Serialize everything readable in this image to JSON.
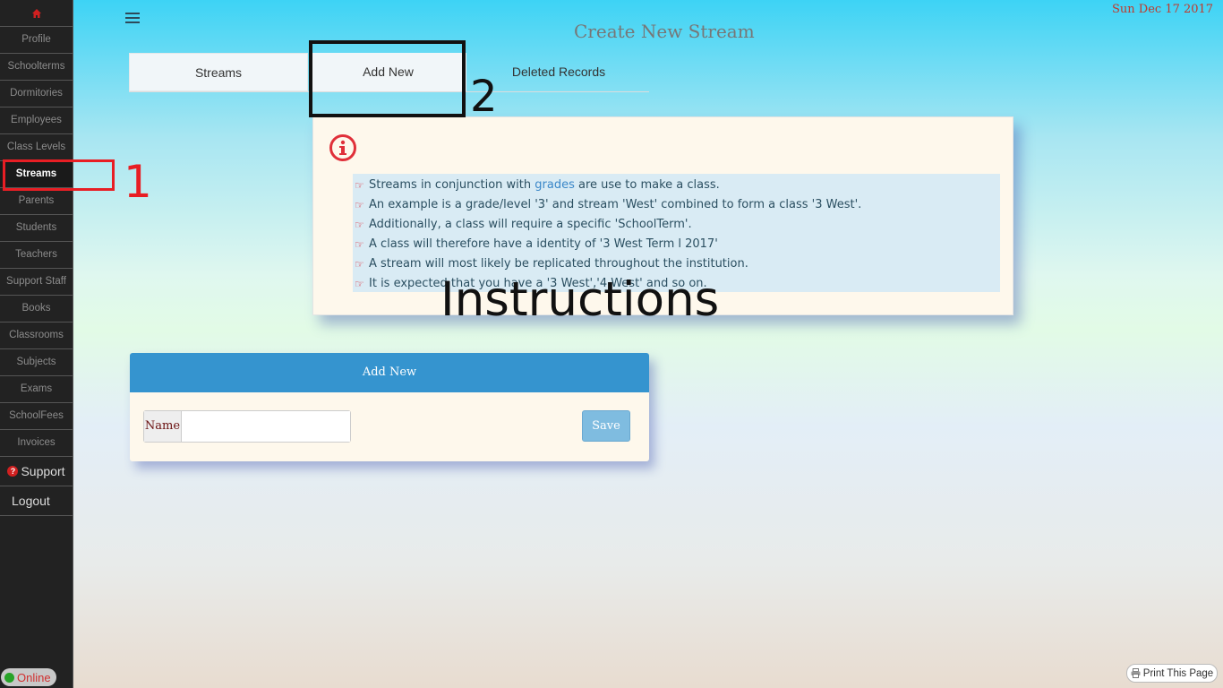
{
  "header": {
    "date": "Sun Dec 17 2017",
    "page_title": "Create New Stream"
  },
  "sidebar": {
    "home_icon": "home-icon",
    "items": [
      {
        "label": "Profile",
        "active": false
      },
      {
        "label": "Schoolterms",
        "active": false
      },
      {
        "label": "Dormitories",
        "active": false
      },
      {
        "label": "Employees",
        "active": false
      },
      {
        "label": "Class Levels",
        "active": false
      },
      {
        "label": "Streams",
        "active": true
      },
      {
        "label": "Parents",
        "active": false
      },
      {
        "label": "Students",
        "active": false
      },
      {
        "label": "Teachers",
        "active": false
      },
      {
        "label": "Support Staff",
        "active": false
      },
      {
        "label": "Books",
        "active": false
      },
      {
        "label": "Classrooms",
        "active": false
      },
      {
        "label": "Subjects",
        "active": false
      },
      {
        "label": "Exams",
        "active": false
      },
      {
        "label": "SchoolFees",
        "active": false
      },
      {
        "label": "Invoices",
        "active": false
      }
    ],
    "support_label": "Support",
    "logout_label": "Logout",
    "online_label": "Online"
  },
  "tabs": [
    {
      "label": "Streams"
    },
    {
      "label": "Add New"
    },
    {
      "label": "Deleted Records"
    }
  ],
  "annotations": {
    "marker_1": "1",
    "marker_2": "2",
    "instructions_label": "Instructions"
  },
  "info": {
    "lines": [
      {
        "pre": "Streams in conjunction with ",
        "link": "grades",
        "post": " are use to make a class."
      },
      {
        "pre": "An example is a grade/level '3' and stream 'West' combined to form a class '3 West'.",
        "link": "",
        "post": ""
      },
      {
        "pre": "Additionally, a class will require a specific 'SchoolTerm'.",
        "link": "",
        "post": ""
      },
      {
        "pre": "A class will therefore have a identity of '3 West Term l 2017'",
        "link": "",
        "post": ""
      },
      {
        "pre": "A stream will most likely be replicated throughout the institution.",
        "link": "",
        "post": ""
      },
      {
        "pre": "It is expected that you have a '3 West','4 West' and so on.",
        "link": "",
        "post": ""
      }
    ]
  },
  "form": {
    "title": "Add New",
    "name_label": "Name",
    "name_value": "",
    "save_label": "Save"
  },
  "footer": {
    "print_label": "Print This Page"
  },
  "colors": {
    "sidebar_bg": "#222222",
    "accent_red": "#e81e24",
    "form_header": "#3594cf",
    "save_button": "#7fbce0"
  }
}
